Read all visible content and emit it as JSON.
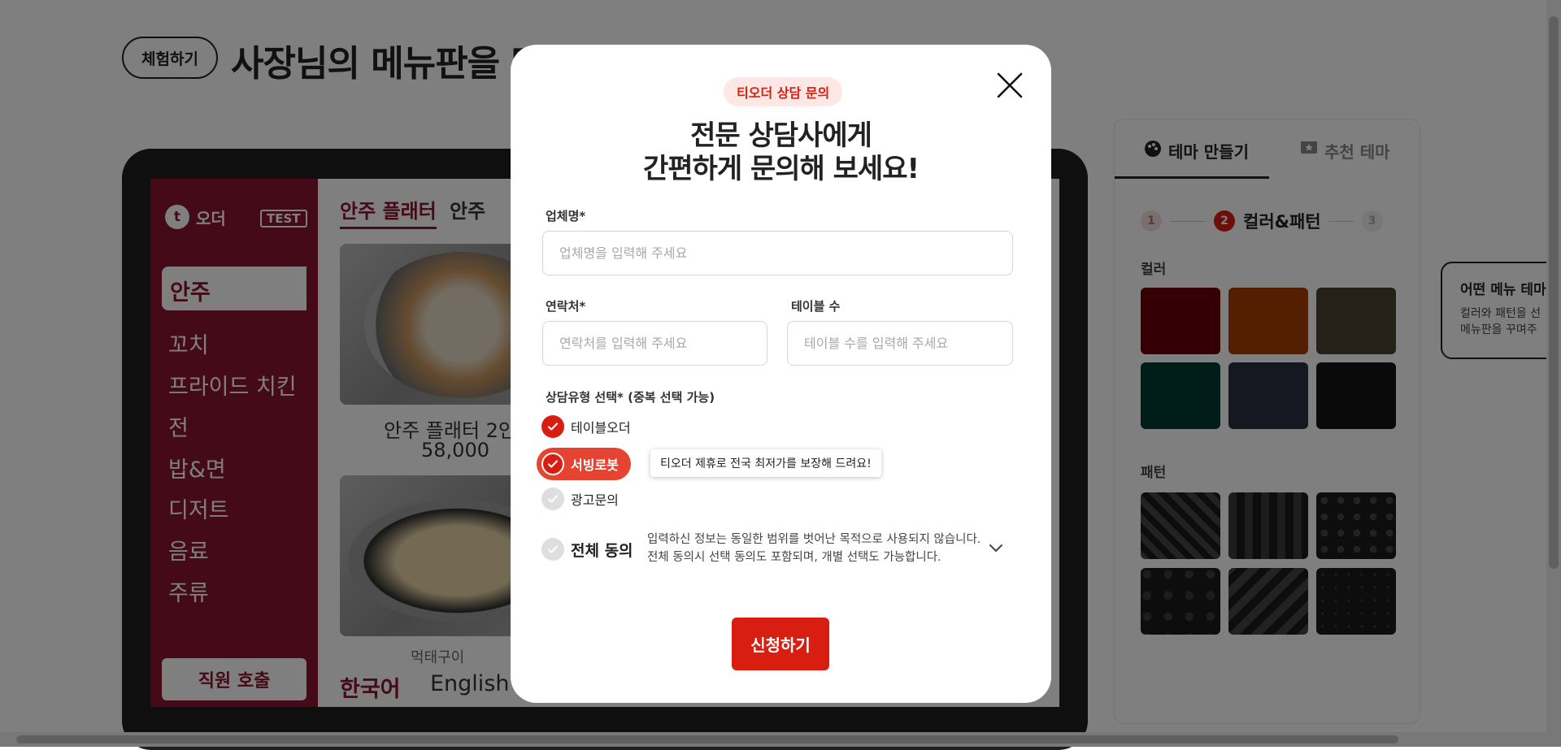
{
  "background": {
    "try_label": "체험하기",
    "page_title": "사장님의 메뉴판을 만들어 보세요",
    "tablet": {
      "logo_text": "오더",
      "test_badge": "TEST",
      "active_category": "안주",
      "categories": [
        "꼬치",
        "프라이드 치킨",
        "전",
        "밥&면",
        "디저트",
        "음료",
        "주류"
      ],
      "staff_call": "직원 호출",
      "menu_tabs": [
        "안주 플래터",
        "안주"
      ],
      "item_name": "안주 플래터 2인",
      "item_price": "58,000",
      "item2_name": "먹태구이",
      "languages": [
        "한국어",
        "English"
      ]
    },
    "theme_panel": {
      "tab_make": "테마 만들기",
      "tab_recommend": "추천 테마",
      "step1": "1",
      "step2": "2",
      "step2_label": "컬러&패턴",
      "step3": "3",
      "color_label": "컬러",
      "pattern_label": "패턴",
      "colors": [
        "#6b0007",
        "#a83c00",
        "#4a4232",
        "#003b35",
        "#2a3042",
        "#141414"
      ]
    },
    "bubble": {
      "title": "어떤 메뉴 테마",
      "line1": "컬러와 패턴을 선",
      "line2": "메뉴판을 꾸며주"
    }
  },
  "modal": {
    "badge": "티오더 상담 문의",
    "headline_line1": "전문 상담사에게",
    "headline_line2": "간편하게 문의해 보세요!",
    "company": {
      "label": "업체명*",
      "placeholder": "업체명을 입력해 주세요",
      "value": ""
    },
    "contact": {
      "label": "연락처*",
      "placeholder": "연락처를 입력해 주세요",
      "value": ""
    },
    "tables": {
      "label": "테이블 수",
      "placeholder": "테이블 수를 입력해 주세요",
      "value": ""
    },
    "consult_type_label": "상담유형 선택* (중복 선택 가능)",
    "options": [
      {
        "label": "테이블오더",
        "checked": true
      },
      {
        "label": "서빙로봇",
        "checked": true
      },
      {
        "label": "광고문의",
        "checked": false
      }
    ],
    "robot_tooltip": "티오더 제휴로 전국 최저가를 보장해 드려요!",
    "agree_all": {
      "label": "전체 동의",
      "checked": false
    },
    "agree_desc_line1": "입력하신 정보는 동일한 범위를 벗어난 목적으로 사용되지 않습니다.",
    "agree_desc_line2": "전체 동의시 선택 동의도 포함되며, 개별 선택도 가능합니다.",
    "submit_label": "신청하기",
    "accent_color": "#d81e10"
  }
}
